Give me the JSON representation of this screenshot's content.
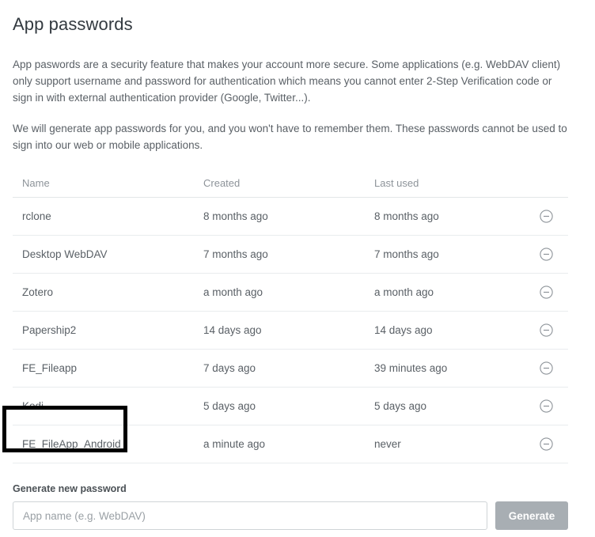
{
  "page": {
    "title": "App passwords",
    "paragraphs": [
      "App paswords are a security feature that makes your account more secure. Some applications (e.g. WebDAV client) only support username and password for authentication which means you cannot enter 2-Step Verification code or sign in with external authentication provider (Google, Twitter...).",
      "We will generate app passwords for you, and you won't have to remember them. These passwords cannot be used to sign into our web or mobile applications."
    ]
  },
  "table": {
    "columns": [
      "Name",
      "Created",
      "Last used"
    ],
    "action_icon": "minus-circle-icon",
    "rows": [
      {
        "name": "rclone",
        "created": "8 months ago",
        "last_used": "8 months ago",
        "highlighted": false
      },
      {
        "name": "Desktop WebDAV",
        "created": "7 months ago",
        "last_used": "7 months ago",
        "highlighted": false
      },
      {
        "name": "Zotero",
        "created": "a month ago",
        "last_used": "a month ago",
        "highlighted": false
      },
      {
        "name": "Papership2",
        "created": "14 days ago",
        "last_used": "14 days ago",
        "highlighted": false
      },
      {
        "name": "FE_Fileapp",
        "created": "7 days ago",
        "last_used": "39 minutes ago",
        "highlighted": false
      },
      {
        "name": "Kodi",
        "created": "5 days ago",
        "last_used": "5 days ago",
        "highlighted": false
      },
      {
        "name": "FE_FileApp_Android",
        "created": "a minute ago",
        "last_used": "never",
        "highlighted": true
      }
    ]
  },
  "generate": {
    "label": "Generate new password",
    "input_value": "",
    "placeholder": "App name (e.g. WebDAV)",
    "button_label": "Generate"
  },
  "colors": {
    "background": "#ffffff",
    "title": "#333a40",
    "body_text": "#5a6066",
    "header_text": "#8d9399",
    "row_divider": "#e9ecee",
    "input_border": "#cfd4d7",
    "button_bg": "#a8aeb3",
    "highlight_box": "#000000"
  }
}
